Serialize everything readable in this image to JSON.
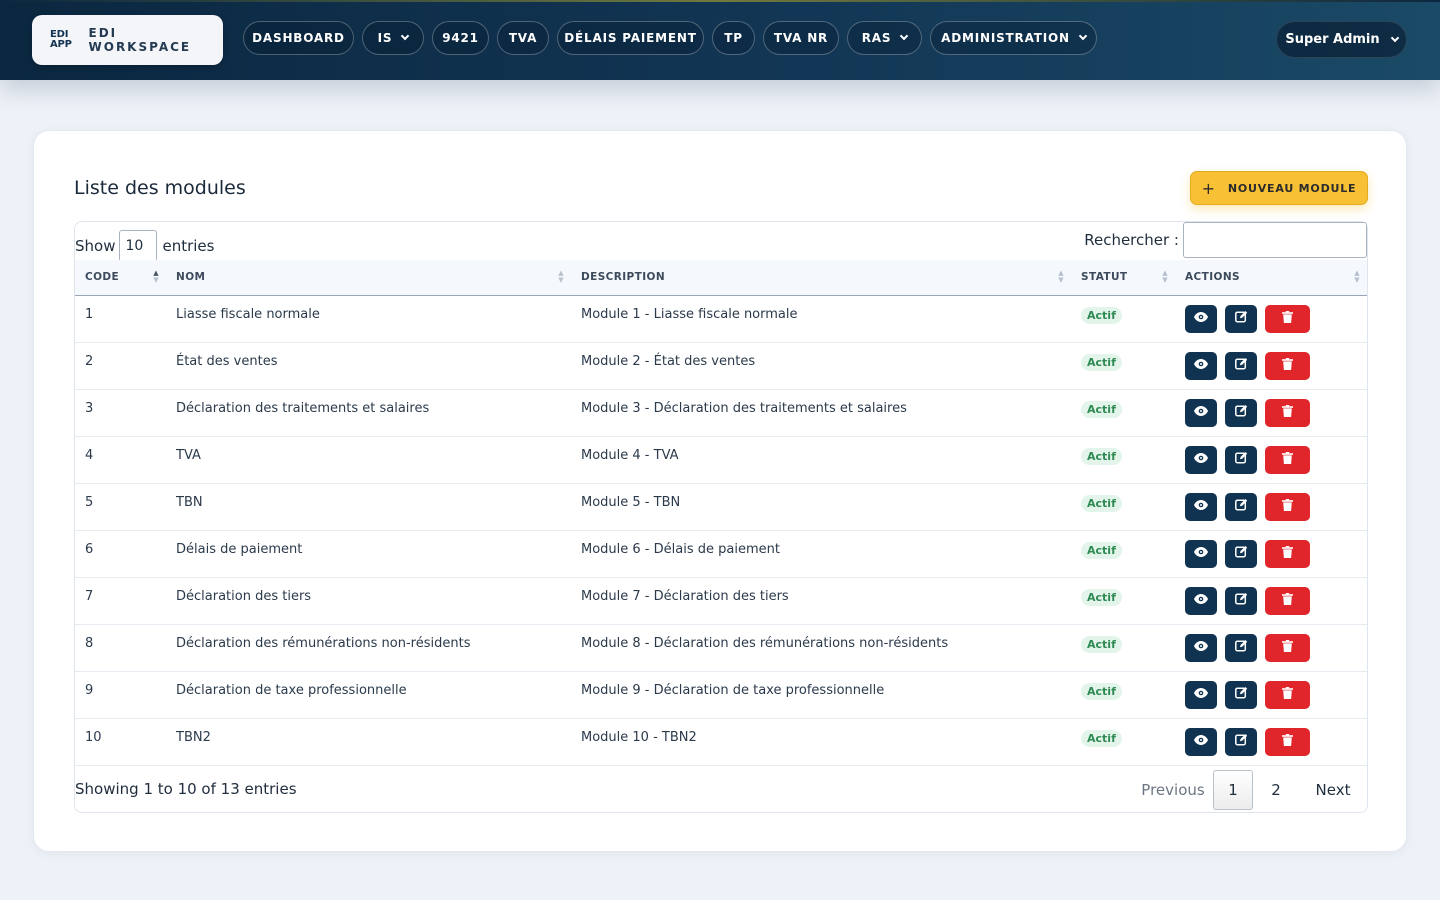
{
  "header": {
    "brand_logo_line1": "EDI",
    "brand_logo_line2": "APP",
    "brand_name": "EDI WORKSPACE",
    "nav": [
      {
        "label": "DASHBOARD",
        "dropdown": false
      },
      {
        "label": "IS",
        "dropdown": true
      },
      {
        "label": "9421",
        "dropdown": false
      },
      {
        "label": "TVA",
        "dropdown": false
      },
      {
        "label": "DÉLAIS PAIEMENT",
        "dropdown": false
      },
      {
        "label": "TP",
        "dropdown": false
      },
      {
        "label": "TVA NR",
        "dropdown": false
      },
      {
        "label": "RAS",
        "dropdown": true
      },
      {
        "label": "ADMINISTRATION",
        "dropdown": true
      }
    ],
    "user": "Super Admin"
  },
  "card": {
    "title": "Liste des modules",
    "new_button": "NOUVEAU MODULE"
  },
  "table": {
    "show_label": "Show",
    "entries_label": "entries",
    "length_value": "10",
    "search_label": "Rechercher :",
    "search_value": "",
    "columns": [
      "CODE",
      "NOM",
      "DESCRIPTION",
      "STATUT",
      "ACTIONS"
    ],
    "rows": [
      {
        "code": "1",
        "nom": "Liasse fiscale normale",
        "description": "Module 1 - Liasse fiscale normale",
        "statut": "Actif"
      },
      {
        "code": "2",
        "nom": "État des ventes",
        "description": "Module 2 - État des ventes",
        "statut": "Actif"
      },
      {
        "code": "3",
        "nom": "Déclaration des traitements et salaires",
        "description": "Module 3 - Déclaration des traitements et salaires",
        "statut": "Actif"
      },
      {
        "code": "4",
        "nom": "TVA",
        "description": "Module 4 - TVA",
        "statut": "Actif"
      },
      {
        "code": "5",
        "nom": "TBN",
        "description": "Module 5 - TBN",
        "statut": "Actif"
      },
      {
        "code": "6",
        "nom": "Délais de paiement",
        "description": "Module 6 - Délais de paiement",
        "statut": "Actif"
      },
      {
        "code": "7",
        "nom": "Déclaration des tiers",
        "description": "Module 7 - Déclaration des tiers",
        "statut": "Actif"
      },
      {
        "code": "8",
        "nom": "Déclaration des rémunérations non-résidents",
        "description": "Module 8 - Déclaration des rémunérations non-résidents",
        "statut": "Actif"
      },
      {
        "code": "9",
        "nom": "Déclaration de taxe professionnelle",
        "description": "Module 9 - Déclaration de taxe professionnelle",
        "statut": "Actif"
      },
      {
        "code": "10",
        "nom": "TBN2",
        "description": "Module 10 - TBN2",
        "statut": "Actif"
      }
    ],
    "info": "Showing 1 to 10 of 13 entries",
    "pagination": {
      "previous": "Previous",
      "pages": [
        "1",
        "2"
      ],
      "current": "1",
      "next": "Next"
    }
  },
  "icons": {
    "view": "eye-icon",
    "edit": "edit-icon",
    "delete": "trash-icon",
    "new": "plus-icon"
  },
  "colors": {
    "primary_dark": "#0f3350",
    "accent": "#f8c135",
    "danger": "#e0262a",
    "success_text": "#2f8a54",
    "success_bg": "#e3f5ea"
  }
}
